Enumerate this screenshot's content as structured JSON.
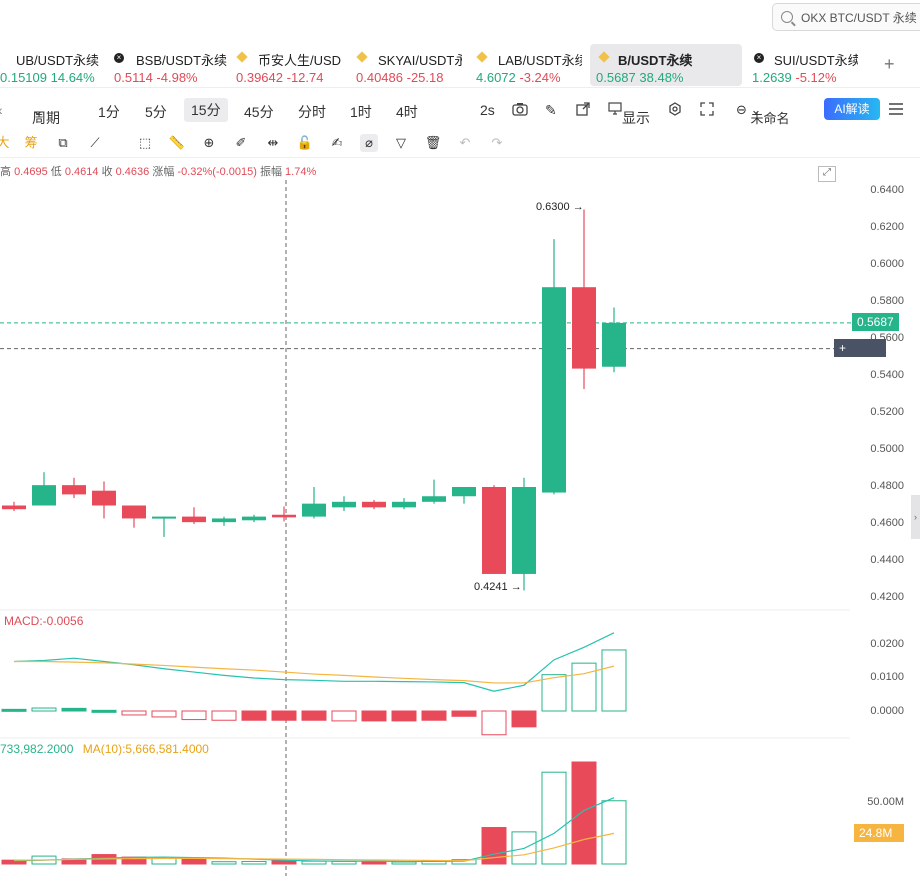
{
  "search": {
    "text": "OKX BTC/USDT 永续"
  },
  "tabs": [
    {
      "name": "UB/USDT永续",
      "price": "0.15109",
      "change": "14.64%",
      "dir": "up",
      "icon": "none"
    },
    {
      "name": "BSB/USDT永续",
      "price": "0.5114",
      "change": "-4.98%",
      "dir": "down",
      "icon": "x-circle-icon"
    },
    {
      "name": "币安人生/USD",
      "price": "0.39642",
      "change": "-12.74",
      "dir": "down",
      "icon": "bnb-icon"
    },
    {
      "name": "SKYAI/USDT永",
      "price": "0.40486",
      "change": "-25.18",
      "dir": "down",
      "icon": "bnb-icon"
    },
    {
      "name": "LAB/USDT永续",
      "price": "4.6072",
      "change": "-3.24%",
      "dir": "up",
      "icon": "bnb-icon"
    },
    {
      "name": "B/USDT永续",
      "price": "0.5687",
      "change": "38.48%",
      "dir": "up",
      "icon": "bnb-icon",
      "active": true
    },
    {
      "name": "SUI/USDT永续",
      "price": "1.2639",
      "change": "-5.12%",
      "dir": "up",
      "icon": "x-circle-icon"
    }
  ],
  "periods": {
    "period_label": "周期",
    "items": [
      "1分",
      "5分",
      "15分",
      "45分",
      "分时",
      "1时",
      "4时"
    ],
    "active": "15分",
    "refresh": "2s",
    "display": "显示",
    "unnamed": "未命名",
    "ai": "AI解读"
  },
  "ohlc": {
    "high_label": "高",
    "high": "0.4695",
    "low_label": "低",
    "low": "0.4614",
    "close_label": "收",
    "close": "0.4636",
    "chg_label": "涨幅",
    "chg": "-0.32%(-0.0015)",
    "amp_label": "振幅",
    "amp": "1.74%"
  },
  "price_axis": [
    "0.6400",
    "0.6200",
    "0.6000",
    "0.5800",
    "0.5600",
    "0.5400",
    "0.5200",
    "0.5000",
    "0.4800",
    "0.4600",
    "0.4400",
    "0.4200"
  ],
  "current_price": "0.5687",
  "crosshair_price": "0.5548",
  "high_marker": "0.6300",
  "low_marker": "0.4241",
  "macd": {
    "label": "MACD:-0.0056",
    "axis": [
      "0.0200",
      "0.0100",
      "0.0000"
    ]
  },
  "volume": {
    "ma5_label": "733,982.2000",
    "ma10_label": "MA(10):5,666,581.4000",
    "axis_top": "50.00M",
    "current": "24.8M"
  },
  "colors": {
    "up": "#26b48a",
    "down": "#e84a5a",
    "accent": "#3b6cff"
  },
  "chart_data": {
    "type": "candlestick",
    "title": "",
    "ylim": [
      0.41,
      0.645
    ],
    "candles": [
      {
        "o": 0.47,
        "h": 0.472,
        "l": 0.467,
        "c": 0.468
      },
      {
        "o": 0.47,
        "h": 0.488,
        "l": 0.47,
        "c": 0.481
      },
      {
        "o": 0.481,
        "h": 0.485,
        "l": 0.474,
        "c": 0.476
      },
      {
        "o": 0.478,
        "h": 0.483,
        "l": 0.463,
        "c": 0.47
      },
      {
        "o": 0.47,
        "h": 0.47,
        "l": 0.458,
        "c": 0.463
      },
      {
        "o": 0.463,
        "h": 0.464,
        "l": 0.453,
        "c": 0.464
      },
      {
        "o": 0.464,
        "h": 0.469,
        "l": 0.46,
        "c": 0.461
      },
      {
        "o": 0.461,
        "h": 0.464,
        "l": 0.459,
        "c": 0.463
      },
      {
        "o": 0.462,
        "h": 0.465,
        "l": 0.461,
        "c": 0.464
      },
      {
        "o": 0.465,
        "h": 0.4695,
        "l": 0.4614,
        "c": 0.4636
      },
      {
        "o": 0.464,
        "h": 0.48,
        "l": 0.463,
        "c": 0.471
      },
      {
        "o": 0.469,
        "h": 0.475,
        "l": 0.467,
        "c": 0.472
      },
      {
        "o": 0.472,
        "h": 0.473,
        "l": 0.468,
        "c": 0.469
      },
      {
        "o": 0.469,
        "h": 0.474,
        "l": 0.468,
        "c": 0.472
      },
      {
        "o": 0.472,
        "h": 0.484,
        "l": 0.471,
        "c": 0.475
      },
      {
        "o": 0.475,
        "h": 0.48,
        "l": 0.471,
        "c": 0.48
      },
      {
        "o": 0.48,
        "h": 0.481,
        "l": 0.433,
        "c": 0.433
      },
      {
        "o": 0.433,
        "h": 0.485,
        "l": 0.4241,
        "c": 0.48
      },
      {
        "o": 0.477,
        "h": 0.614,
        "l": 0.476,
        "c": 0.588
      },
      {
        "o": 0.588,
        "h": 0.63,
        "l": 0.533,
        "c": 0.544
      },
      {
        "o": 0.545,
        "h": 0.577,
        "l": 0.542,
        "c": 0.5687
      }
    ],
    "macd_hist": [
      0.0005,
      0.0009,
      0.0008,
      0.0002,
      -0.0012,
      -0.0018,
      -0.0026,
      -0.0028,
      -0.0028,
      -0.0028,
      -0.0028,
      -0.003,
      -0.003,
      -0.003,
      -0.0028,
      -0.0016,
      -0.0072,
      -0.0048,
      0.011,
      0.0145,
      0.0185
    ],
    "macd_dif": [
      0.015,
      0.0153,
      0.016,
      0.015,
      0.014,
      0.0128,
      0.0118,
      0.0108,
      0.01,
      0.0095,
      0.0093,
      0.009,
      0.009,
      0.0089,
      0.0088,
      0.0086,
      0.006,
      0.0078,
      0.0155,
      0.0193,
      0.0237
    ],
    "macd_dea": [
      0.015,
      0.015,
      0.0148,
      0.0146,
      0.0142,
      0.0138,
      0.0133,
      0.0128,
      0.0124,
      0.0118,
      0.0112,
      0.0108,
      0.0103,
      0.0099,
      0.0095,
      0.0092,
      0.0085,
      0.0085,
      0.0101,
      0.0113,
      0.0136
    ],
    "volume": [
      1.5,
      3.1,
      2.0,
      3.7,
      2.7,
      2.2,
      1.8,
      0.9,
      1.0,
      1.4,
      1.1,
      1.0,
      1.0,
      0.8,
      1.2,
      1.7,
      14.3,
      12.6,
      36.0,
      40.0,
      24.8
    ],
    "volume_ma5": [
      1.2,
      1.5,
      1.9,
      2.3,
      2.6,
      2.7,
      2.5,
      2.3,
      1.9,
      1.5,
      1.2,
      1.1,
      1.1,
      1.0,
      1.0,
      1.1,
      3.9,
      6.1,
      12.0,
      21.0,
      26.0
    ],
    "volume_ma10": [
      1.5,
      1.6,
      1.8,
      2.0,
      2.1,
      2.2,
      2.2,
      2.1,
      2.0,
      1.9,
      1.8,
      1.7,
      1.6,
      1.5,
      1.4,
      1.3,
      2.5,
      3.6,
      6.3,
      9.6,
      12.0
    ]
  }
}
